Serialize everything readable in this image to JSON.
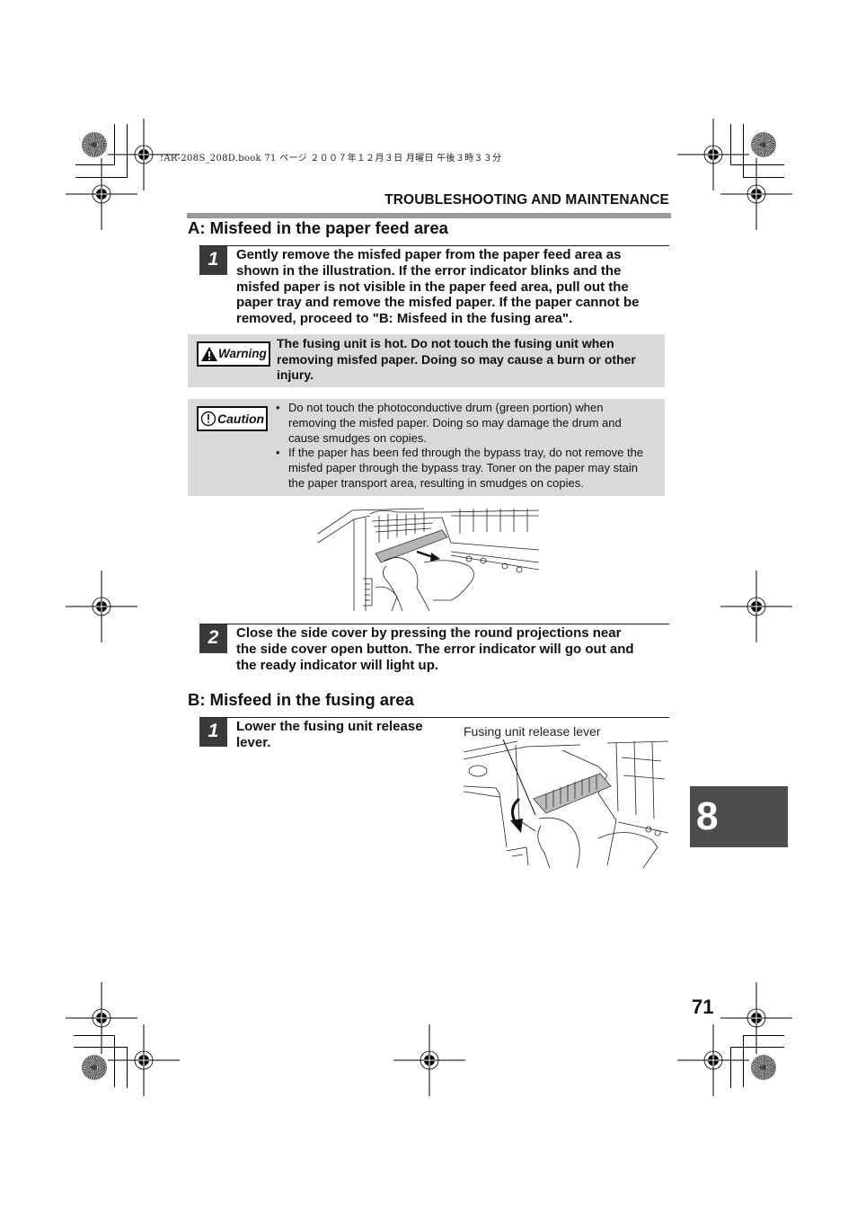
{
  "print_slug": "!AR-208S_208D.book  71 ページ  ２００７年１２月３日  月曜日  午後３時３３分",
  "running_head": "TROUBLESHOOTING AND MAINTENANCE",
  "section_a": {
    "title": "A: Misfeed in the paper feed area",
    "steps": [
      {
        "number": "1",
        "lines": [
          "Gently remove the misfed paper from the paper feed area as",
          "shown in the illustration. If the error indicator blinks and the",
          "misfed paper is not visible in the paper feed area, pull out the",
          "paper tray and remove the misfed paper. If the paper cannot be",
          "removed, proceed to \"B: Misfeed in the fusing area\"."
        ]
      },
      {
        "number": "2",
        "lines": [
          "Close the side cover by pressing the round projections near",
          "the side cover open button. The error indicator will go out and",
          "the ready indicator will light up."
        ]
      }
    ],
    "warning": {
      "badge_label": "Warning",
      "icon": "warning-triangle-icon",
      "lines": [
        "The fusing unit is hot. Do not touch the fusing unit when",
        "removing misfed paper. Doing so may cause a burn or other",
        "injury."
      ]
    },
    "caution": {
      "badge_label": "Caution",
      "icon": "exclamation-circle-icon",
      "items": [
        [
          "Do not touch the photoconductive drum (green portion) when",
          "removing the misfed paper. Doing so may damage the drum and",
          "cause smudges on copies."
        ],
        [
          "If the paper has been fed through the bypass tray, do not remove the",
          "misfed paper through the bypass tray. Toner on the paper may stain",
          "the paper transport area, resulting in smudges on copies."
        ]
      ]
    },
    "figure": {
      "description": "Hands removing misfed paper from the paper feed area"
    }
  },
  "section_b": {
    "title": "B: Misfeed in the fusing area",
    "steps": [
      {
        "number": "1",
        "lines": [
          "Lower the fusing unit release",
          "lever."
        ]
      }
    ],
    "figure": {
      "caption": "Fusing unit release lever",
      "description": "Hand lowering the fusing unit release lever"
    }
  },
  "chapter_tab": "8",
  "page_number": "71"
}
